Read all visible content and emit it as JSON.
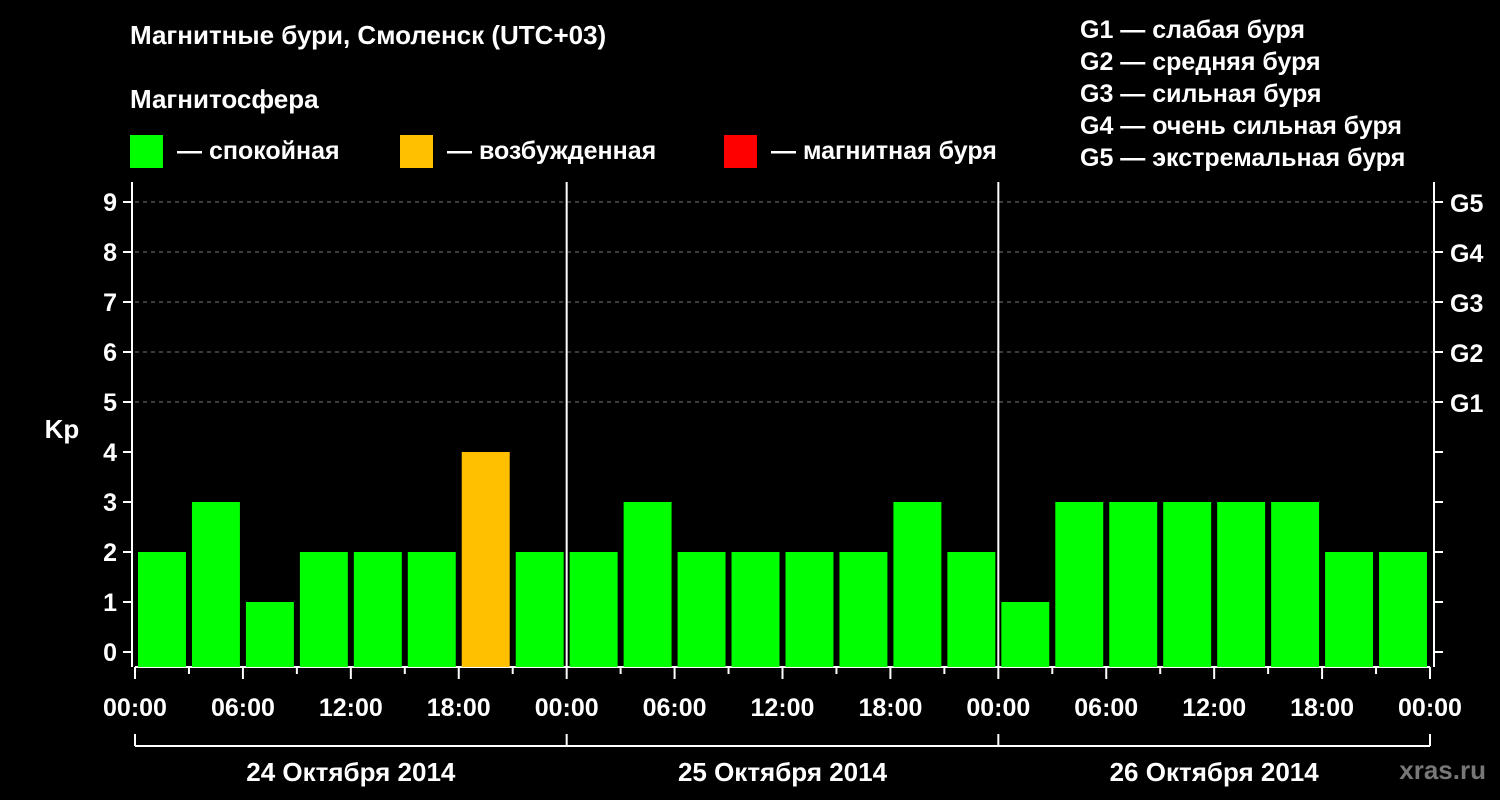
{
  "header": {
    "title": "Магнитные бури, Смоленск (UTC+03)",
    "subtitle": "Магнитосфера"
  },
  "legend": [
    {
      "label": "— спокойная",
      "color": "#00ff00"
    },
    {
      "label": "— возбужденная",
      "color": "#ffc000"
    },
    {
      "label": "— магнитная буря",
      "color": "#ff0000"
    }
  ],
  "g_scale": [
    "G1 — слабая буря",
    "G2 — средняя буря",
    "G3 — сильная буря",
    "G4 — очень сильная буря",
    "G5 — экстремальная буря"
  ],
  "watermark": "xras.ru",
  "chart_data": {
    "type": "bar",
    "ylabel": "Kp",
    "ylim": [
      0,
      9
    ],
    "yticks": [
      "0",
      "1",
      "2",
      "3",
      "4",
      "5",
      "6",
      "7",
      "8",
      "9"
    ],
    "right_ticks": [
      {
        "kp": 5,
        "label": "G1"
      },
      {
        "kp": 6,
        "label": "G2"
      },
      {
        "kp": 7,
        "label": "G3"
      },
      {
        "kp": 8,
        "label": "G4"
      },
      {
        "kp": 9,
        "label": "G5"
      }
    ],
    "grid": "dashed horizontal lines at Kp 5–9",
    "xticks": [
      "00:00",
      "06:00",
      "12:00",
      "18:00",
      "00:00",
      "06:00",
      "12:00",
      "18:00",
      "00:00",
      "06:00",
      "12:00",
      "18:00",
      "00:00"
    ],
    "days": [
      "24 Октября 2014",
      "25 Октября 2014",
      "26 Октября 2014"
    ],
    "interval_hours": 3,
    "values": [
      2,
      3,
      1,
      2,
      2,
      2,
      4,
      2,
      2,
      3,
      2,
      2,
      2,
      2,
      3,
      2,
      1,
      3,
      3,
      3,
      3,
      3,
      2,
      2
    ],
    "colors": {
      "quiet": "#00ff00",
      "active": "#ffc000",
      "storm": "#ff0000"
    },
    "thresholds": {
      "active_from": 4,
      "storm_from": 5
    }
  }
}
